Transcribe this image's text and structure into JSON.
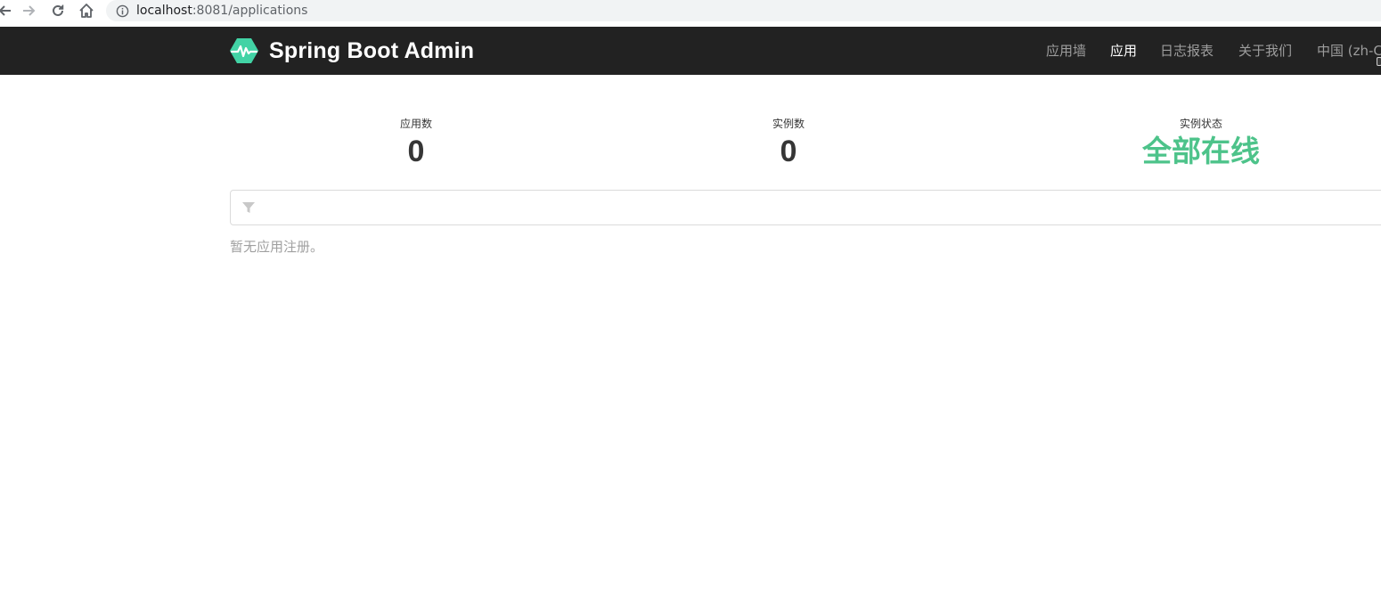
{
  "browser": {
    "back_icon": "back-arrow-icon",
    "forward_icon": "forward-arrow-icon",
    "reload_icon": "reload-icon",
    "home_icon": "home-icon",
    "info_icon": "info-icon",
    "url_host": "localhost",
    "url_rest": ":8081/applications"
  },
  "navbar": {
    "brand_title": "Spring Boot Admin",
    "brand_color": "#42d3a5",
    "items": [
      {
        "label": "应用墙",
        "active": false
      },
      {
        "label": "应用",
        "active": true
      },
      {
        "label": "日志报表",
        "active": false
      },
      {
        "label": "关于我们",
        "active": false
      },
      {
        "label": "中国 (zh-C",
        "active": false
      }
    ]
  },
  "stats": {
    "applications_label": "应用数",
    "applications_value": "0",
    "instances_label": "实例数",
    "instances_value": "0",
    "status_label": "实例状态",
    "status_value": "全部在线",
    "status_color": "#4dc38a"
  },
  "filter": {
    "icon": "filter-icon",
    "value": "",
    "placeholder": ""
  },
  "empty_message": "暂无应用注册。"
}
